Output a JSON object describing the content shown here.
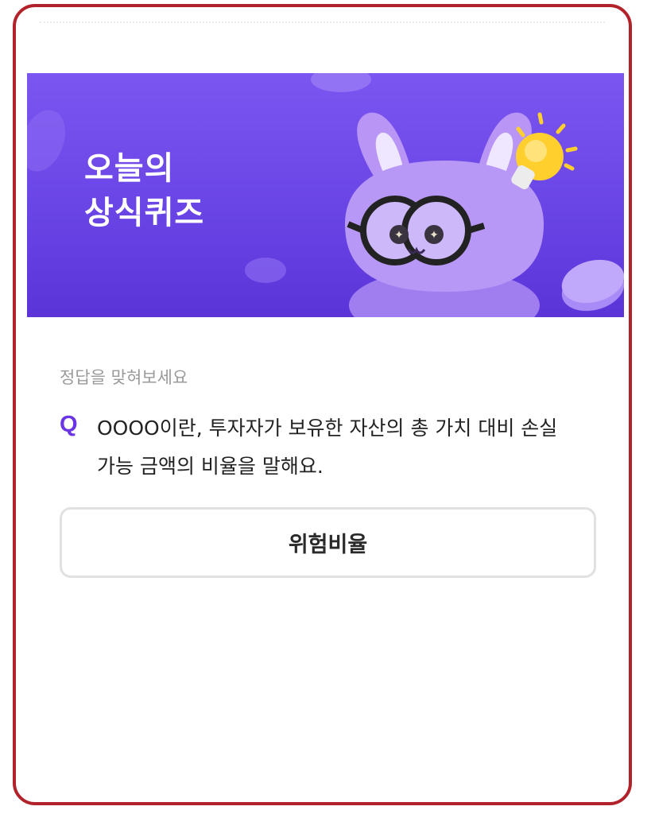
{
  "banner": {
    "title_line1": "오늘의",
    "title_line2": "상식퀴즈"
  },
  "quiz": {
    "prompt": "정답을 맞혀보세요",
    "q_label": "Q",
    "question": "OOOO이란, 투자자가 보유한 자산의 총 가치 대비 손실 가능 금액의 비율을 말해요.",
    "answer_label": "위험비율"
  },
  "colors": {
    "frame_border": "#b1222a",
    "banner_bg": "#6a45e6",
    "accent": "#6a35e4",
    "button_border": "#e1e1e1"
  },
  "icons": [
    "rabbit-mascot-icon",
    "lightbulb-icon",
    "coin-icon"
  ]
}
